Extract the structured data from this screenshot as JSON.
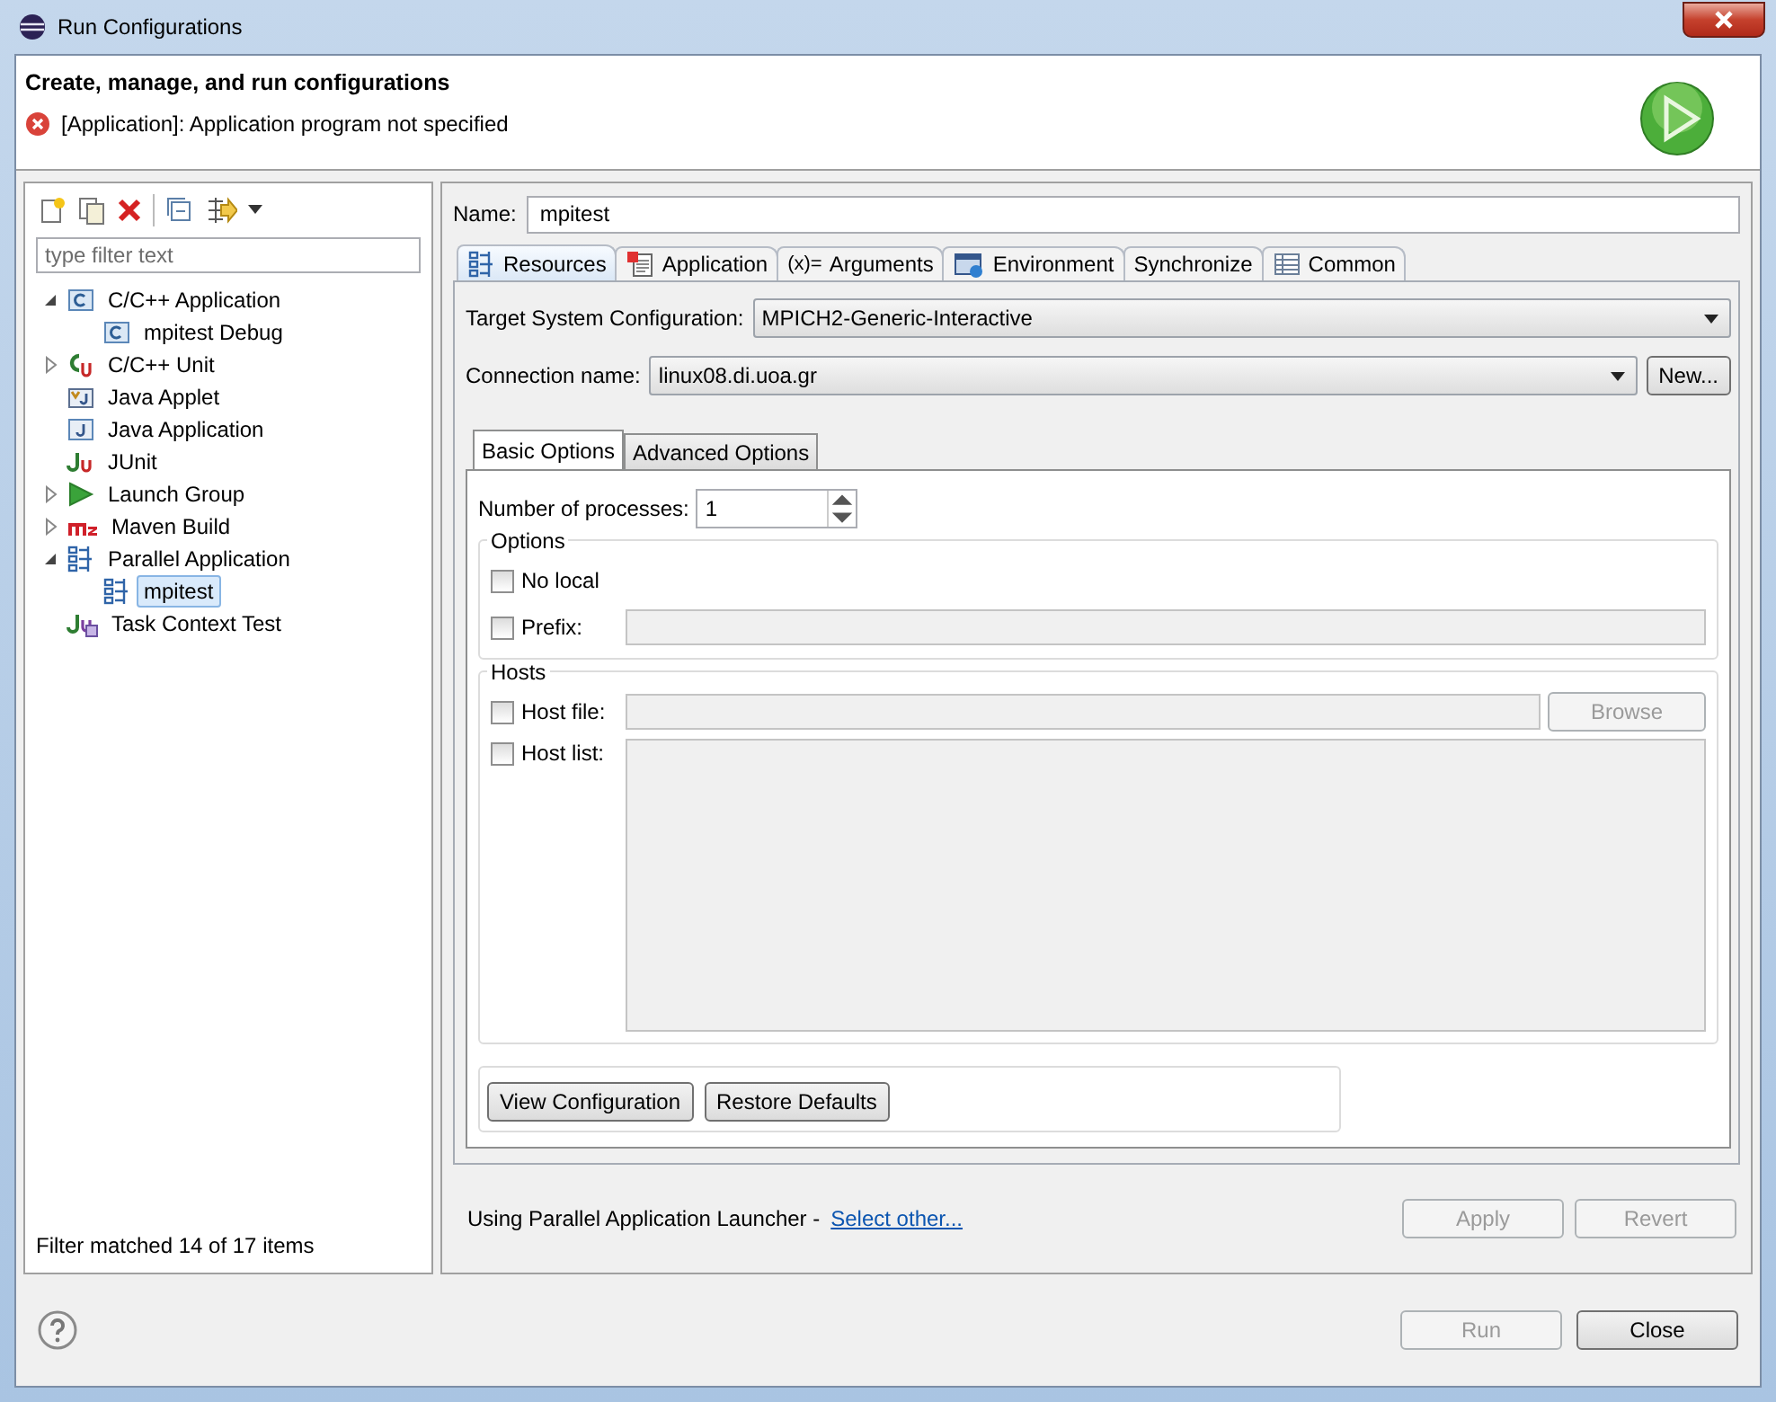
{
  "window": {
    "title": "Run Configurations"
  },
  "header": {
    "title": "Create, manage, and run configurations",
    "message": "[Application]: Application program not specified"
  },
  "sidebar": {
    "filter_placeholder": "type filter text",
    "status": "Filter matched 14 of 17 items",
    "tree": [
      {
        "label": "C/C++ Application",
        "kind": "cfile",
        "expanded": true,
        "selected": false,
        "children": [
          {
            "label": "mpitest Debug",
            "kind": "cfile",
            "selected": false
          }
        ]
      },
      {
        "label": "C/C++ Unit",
        "kind": "unit",
        "expanded": false,
        "selected": false
      },
      {
        "label": "Java Applet",
        "kind": "applet",
        "selected": false
      },
      {
        "label": "Java Application",
        "kind": "javafile",
        "selected": false
      },
      {
        "label": "JUnit",
        "kind": "junit",
        "selected": false
      },
      {
        "label": "Launch Group",
        "kind": "play",
        "expanded": false,
        "selected": false
      },
      {
        "label": "Maven Build",
        "kind": "module",
        "expanded": false,
        "selected": false
      },
      {
        "label": "Parallel Application",
        "kind": "parallel",
        "expanded": true,
        "selected": false,
        "children": [
          {
            "label": "mpitest",
            "kind": "parallel",
            "selected": true
          }
        ]
      },
      {
        "label": "Task Context Test",
        "kind": "task",
        "selected": false
      }
    ]
  },
  "name_field": {
    "label": "Name:",
    "value": "mpitest"
  },
  "tabs": [
    {
      "label": "Resources",
      "kind": "parallel",
      "selected": true
    },
    {
      "label": "Application",
      "kind": "document",
      "selected": false
    },
    {
      "label": "Arguments",
      "kind": "glyph",
      "glyph": "(x)=",
      "selected": false
    },
    {
      "label": "Environment",
      "kind": "environment",
      "selected": false
    },
    {
      "label": "Synchronize",
      "kind": "plain",
      "selected": false
    },
    {
      "label": "Common",
      "kind": "table",
      "selected": false
    }
  ],
  "target": {
    "label": "Target System Configuration:",
    "value": "MPICH2-Generic-Interactive"
  },
  "connection": {
    "label": "Connection name:",
    "value": "linux08.di.uoa.gr",
    "button": "New..."
  },
  "inner_tabs": [
    {
      "label": "Basic Options",
      "selected": true
    },
    {
      "label": "Advanced Options",
      "selected": false
    }
  ],
  "processes": {
    "label": "Number of processes:",
    "value": "1"
  },
  "options_group": {
    "title": "Options",
    "items": [
      {
        "label": "No local",
        "kind": "check",
        "checked": false
      },
      {
        "label": "Prefix:",
        "kind": "field",
        "checked": false,
        "field_disabled": true
      }
    ]
  },
  "hosts_group": {
    "title": "Hosts",
    "items": [
      {
        "label": "Host file:",
        "kind": "file",
        "checked": false,
        "field_disabled": true,
        "button": {
          "label": "Browse",
          "disabled": true
        }
      },
      {
        "label": "Host list:",
        "kind": "area",
        "checked": false,
        "field_disabled": true
      }
    ]
  },
  "option_buttons": [
    {
      "label": "View Configuration"
    },
    {
      "label": "Restore Defaults"
    }
  ],
  "launcher": {
    "text": "Using Parallel Application Launcher - ",
    "link": "Select other..."
  },
  "config_buttons": [
    {
      "label": "Apply",
      "disabled": true
    },
    {
      "label": "Revert",
      "disabled": true
    }
  ],
  "dialog_buttons": [
    {
      "label": "Run",
      "disabled": true
    },
    {
      "label": "Close",
      "disabled": false
    }
  ]
}
